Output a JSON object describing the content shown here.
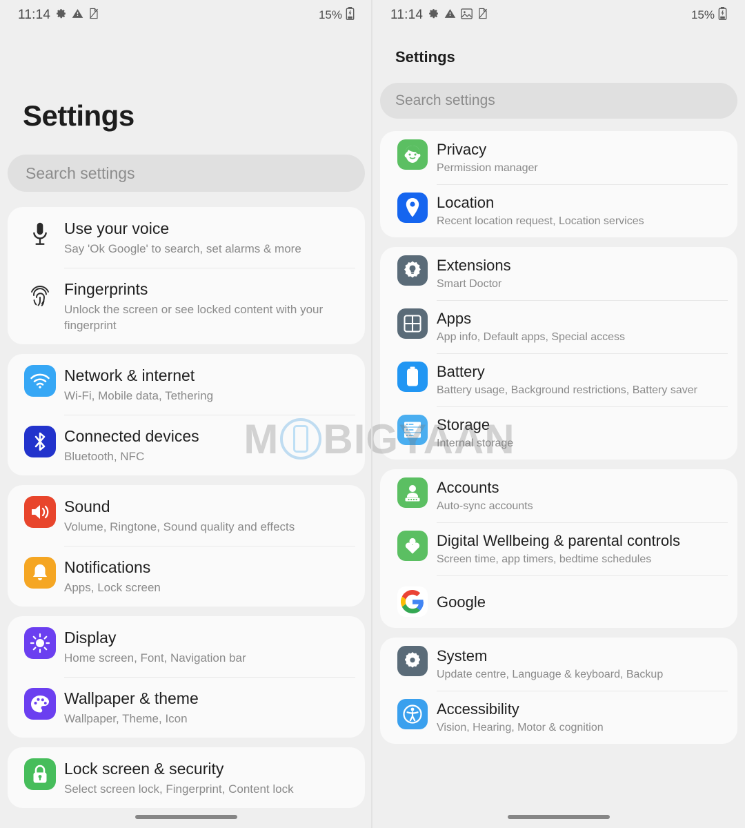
{
  "left_panel": {
    "status_bar": {
      "time": "11:14",
      "battery_percent": "15%",
      "icons": [
        "gear-icon",
        "warning-triangle-icon",
        "no-sim-document-icon"
      ],
      "battery_icon": "battery-low-icon"
    },
    "title": "Settings",
    "search": {
      "placeholder": "Search settings"
    },
    "groups": [
      {
        "rows": [
          {
            "icon": "microphone-icon",
            "icon_style": "plain",
            "title": "Use your voice",
            "subtitle": "Say 'Ok Google' to search, set alarms & more"
          },
          {
            "icon": "fingerprint-icon",
            "icon_style": "plain",
            "title": "Fingerprints",
            "subtitle": "Unlock the screen or see locked content with your fingerprint"
          }
        ]
      },
      {
        "rows": [
          {
            "icon": "wifi-icon",
            "icon_style": "tile",
            "color": "#36a7f5",
            "title": "Network & internet",
            "subtitle": "Wi-Fi, Mobile data, Tethering"
          },
          {
            "icon": "bluetooth-icon",
            "icon_style": "tile",
            "color": "#2233cc",
            "title": "Connected devices",
            "subtitle": "Bluetooth, NFC"
          }
        ]
      },
      {
        "rows": [
          {
            "icon": "speaker-volume-icon",
            "icon_style": "tile",
            "color": "#e8452c",
            "title": "Sound",
            "subtitle": "Volume, Ringtone, Sound quality and effects"
          },
          {
            "icon": "bell-notification-icon",
            "icon_style": "tile",
            "color": "#f5a623",
            "title": "Notifications",
            "subtitle": "Apps, Lock screen"
          }
        ]
      },
      {
        "rows": [
          {
            "icon": "brightness-sun-icon",
            "icon_style": "tile",
            "color": "#6b3ff0",
            "title": "Display",
            "subtitle": "Home screen, Font, Navigation bar"
          },
          {
            "icon": "palette-icon",
            "icon_style": "tile",
            "color": "#6b3ff0",
            "title": "Wallpaper & theme",
            "subtitle": "Wallpaper, Theme, Icon"
          }
        ]
      },
      {
        "rows": [
          {
            "icon": "padlock-icon",
            "icon_style": "tile",
            "color": "#46bd5b",
            "title": "Lock screen & security",
            "subtitle": "Select screen lock, Fingerprint, Content lock"
          }
        ]
      }
    ]
  },
  "right_panel": {
    "status_bar": {
      "time": "11:14",
      "battery_percent": "15%",
      "icons": [
        "gear-icon",
        "warning-triangle-icon",
        "image-icon",
        "no-sim-document-icon"
      ],
      "battery_icon": "battery-low-icon"
    },
    "title": "Settings",
    "search": {
      "placeholder": "Search settings"
    },
    "groups": [
      {
        "rows": [
          {
            "icon": "privacy-face-icon",
            "icon_style": "tile",
            "color": "#5bbf62",
            "title": "Privacy",
            "subtitle": "Permission manager"
          },
          {
            "icon": "location-pin-icon",
            "icon_style": "tile",
            "color": "#1565ef",
            "title": "Location",
            "subtitle": "Recent location request, Location services"
          }
        ]
      },
      {
        "rows": [
          {
            "icon": "gear-bulb-icon",
            "icon_style": "tile",
            "color": "#5a6b78",
            "title": "Extensions",
            "subtitle": "Smart Doctor"
          },
          {
            "icon": "apps-grid-icon",
            "icon_style": "tile",
            "color": "#5a6b78",
            "title": "Apps",
            "subtitle": "App info, Default apps, Special access"
          },
          {
            "icon": "battery-icon",
            "icon_style": "tile",
            "color": "#2196f3",
            "title": "Battery",
            "subtitle": "Battery usage, Background restrictions, Battery saver"
          },
          {
            "icon": "storage-server-icon",
            "icon_style": "tile",
            "color": "#4aaef0",
            "title": "Storage",
            "subtitle": "Internal storage"
          }
        ]
      },
      {
        "rows": [
          {
            "icon": "accounts-person-icon",
            "icon_style": "tile",
            "color": "#5bbf62",
            "title": "Accounts",
            "subtitle": "Auto-sync accounts"
          },
          {
            "icon": "wellbeing-heart-icon",
            "icon_style": "tile",
            "color": "#5bbf62",
            "title": "Digital Wellbeing & parental controls",
            "subtitle": "Screen time, app timers, bedtime schedules"
          },
          {
            "icon": "google-g-icon",
            "icon_style": "google",
            "color": "#ffffff",
            "title": "Google",
            "subtitle": ""
          }
        ]
      },
      {
        "rows": [
          {
            "icon": "gear-icon",
            "icon_style": "tile",
            "color": "#5a6b78",
            "title": "System",
            "subtitle": "Update centre, Language & keyboard, Backup"
          },
          {
            "icon": "accessibility-icon",
            "icon_style": "tile",
            "color": "#3aa0ee",
            "title": "Accessibility",
            "subtitle": "Vision, Hearing, Motor & cognition"
          }
        ]
      }
    ]
  },
  "watermark": {
    "text_before": "M",
    "text_after": "BIGYAAN",
    "full": "MOBIGYAAN"
  }
}
